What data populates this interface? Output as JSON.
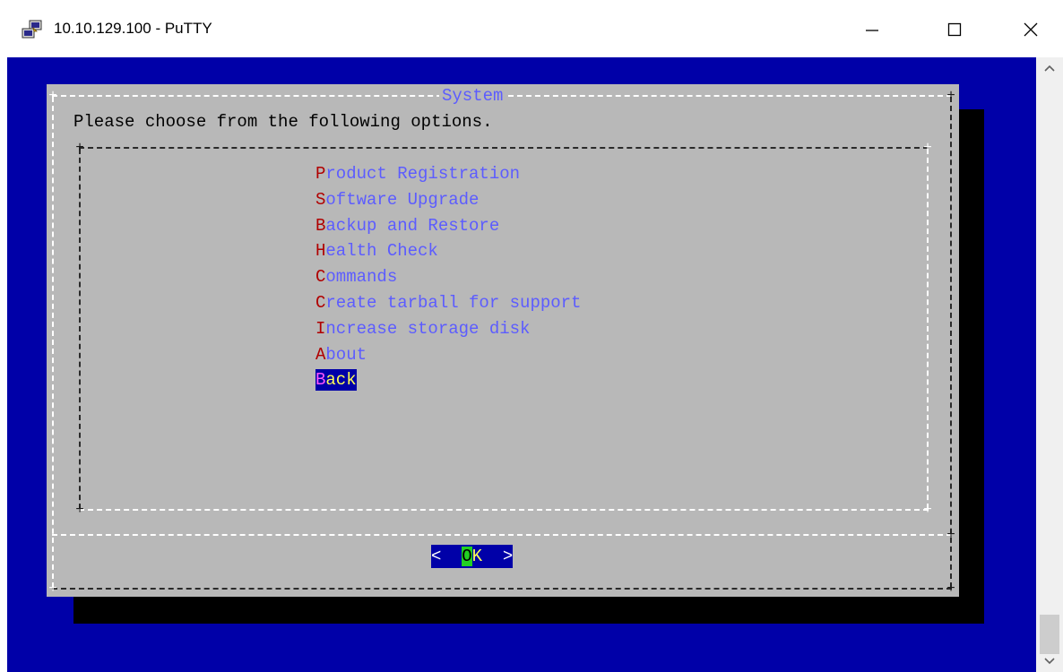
{
  "window": {
    "title": "10.10.129.100 - PuTTY",
    "icon": "putty-icon",
    "controls": [
      "minimize-icon",
      "maximize-icon",
      "close-icon"
    ]
  },
  "dialog": {
    "title": "System",
    "prompt": "Please choose from the following options.",
    "menu": [
      {
        "hotkey": "P",
        "rest": "roduct Registration",
        "selected": false
      },
      {
        "hotkey": "S",
        "rest": "oftware Upgrade",
        "selected": false
      },
      {
        "hotkey": "B",
        "rest": "ackup and Restore",
        "selected": false
      },
      {
        "hotkey": "H",
        "rest": "ealth Check",
        "selected": false
      },
      {
        "hotkey": "C",
        "rest": "ommands",
        "selected": false
      },
      {
        "hotkey": "C",
        "rest": "reate tarball for support",
        "selected": false
      },
      {
        "hotkey": "I",
        "rest": "ncrease storage disk",
        "selected": false
      },
      {
        "hotkey": "A",
        "rest": "bout",
        "selected": false
      },
      {
        "hotkey": "B",
        "rest": "ack",
        "selected": true
      }
    ],
    "ok_button": {
      "left": "<  ",
      "hotkey": "O",
      "rest": "K",
      "right": "  >"
    }
  },
  "colors": {
    "terminal_background": "#0000a8",
    "dialog_background": "#b8b8b8",
    "menu_text": "#5c5cff",
    "hotkey": "#b00000",
    "selected_background": "#0000a8",
    "selected_text": "#ffff55",
    "ok_hotkey_background": "#22d022"
  },
  "scrollbar": {
    "up_icon": "chevron-up-icon",
    "down_icon": "chevron-down-icon"
  }
}
